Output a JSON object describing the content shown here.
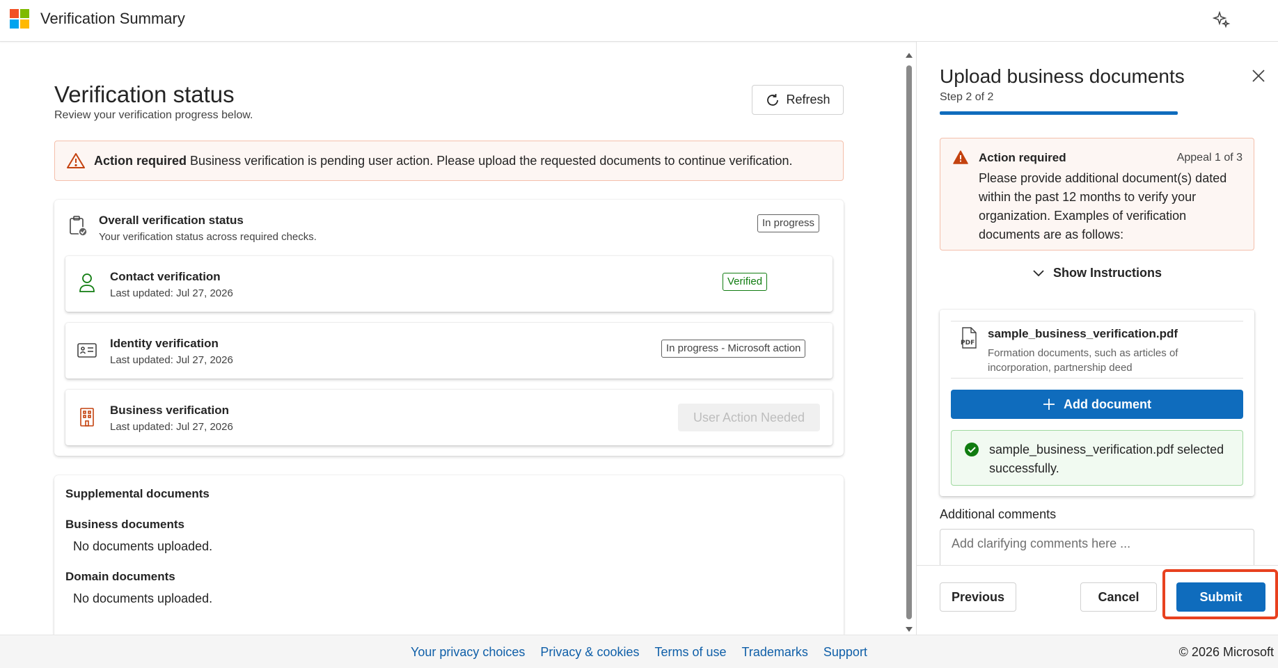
{
  "header": {
    "app_title": "Verification Summary",
    "logo_colors": [
      "#f25022",
      "#7fba00",
      "#00a4ef",
      "#ffb900"
    ]
  },
  "main": {
    "title": "Verification status",
    "subtitle": "Review your verification progress below.",
    "refresh_label": "Refresh",
    "alert": {
      "title": "Action required",
      "message": "Business verification is pending user action. Please upload the requested documents to continue verification."
    },
    "overall": {
      "title": "Overall verification status",
      "subtitle": "Your verification status across required checks.",
      "badge": "In progress"
    },
    "rows": [
      {
        "title": "Contact verification",
        "updated": "Last updated: Jul 27, 2026",
        "status": "Verified",
        "icon": "person-icon"
      },
      {
        "title": "Identity verification",
        "updated": "Last updated: Jul 27, 2026",
        "status": "In progress - Microsoft action",
        "icon": "id-card-icon"
      },
      {
        "title": "Business verification",
        "updated": "Last updated: Jul 27, 2026",
        "status": "User Action Needed",
        "icon": "building-icon"
      }
    ],
    "supplemental": {
      "title": "Supplemental documents",
      "business_heading": "Business documents",
      "business_value": "No documents uploaded.",
      "domain_heading": "Domain documents",
      "domain_value": "No documents uploaded."
    }
  },
  "panel": {
    "title": "Upload business documents",
    "step": "Step 2 of 2",
    "alert": {
      "title": "Action required",
      "appeal": "Appeal 1 of 3",
      "body": "Please provide additional document(s) dated within the past 12 months to verify your organization. Examples of verification documents are as follows:"
    },
    "show_instructions": "Show Instructions",
    "document": {
      "name": "sample_business_verification.pdf",
      "description": "Formation documents, such as articles of incorporation, partnership deed"
    },
    "add_document_label": "Add document",
    "success_message": "sample_business_verification.pdf selected successfully.",
    "comments_label": "Additional comments",
    "comments_placeholder": "Add clarifying comments here ...",
    "comments_value": "",
    "previous_label": "Previous",
    "cancel_label": "Cancel",
    "submit_label": "Submit"
  },
  "footer": {
    "links": [
      "Your privacy choices",
      "Privacy & cookies",
      "Terms of use",
      "Trademarks",
      "Support"
    ],
    "copyright": "© 2026 Microsoft"
  },
  "colors": {
    "accent": "#0f6cbd",
    "verified": "#107c10",
    "warning": "#c4420f",
    "highlight": "#e8411f"
  }
}
